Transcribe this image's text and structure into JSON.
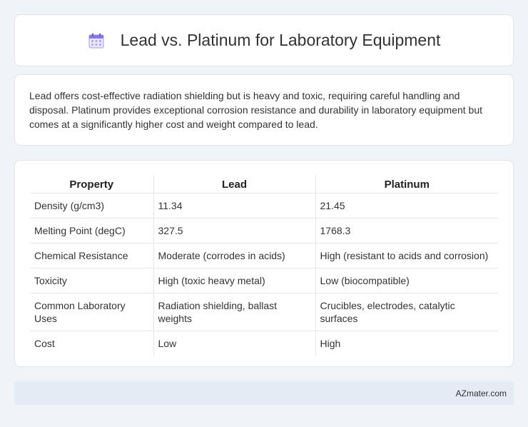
{
  "header": {
    "title": "Lead vs. Platinum for Laboratory Equipment",
    "icon": "calendar-icon",
    "icon_color": "#8b78e6"
  },
  "summary": {
    "text": "Lead offers cost-effective radiation shielding but is heavy and toxic, requiring careful handling and disposal. Platinum provides exceptional corrosion resistance and durability in laboratory equipment but comes at a significantly higher cost and weight compared to lead."
  },
  "table": {
    "headers": [
      "Property",
      "Lead",
      "Platinum"
    ],
    "rows": [
      [
        "Density (g/cm3)",
        "11.34",
        "21.45"
      ],
      [
        "Melting Point (degC)",
        "327.5",
        "1768.3"
      ],
      [
        "Chemical Resistance",
        "Moderate (corrodes in acids)",
        "High (resistant to acids and corrosion)"
      ],
      [
        "Toxicity",
        "High (toxic heavy metal)",
        "Low (biocompatible)"
      ],
      [
        "Common Laboratory Uses",
        "Radiation shielding, ballast weights",
        "Crucibles, electrodes, catalytic surfaces"
      ],
      [
        "Cost",
        "Low",
        "High"
      ]
    ]
  },
  "footer": {
    "brand": "AZmater.com"
  }
}
